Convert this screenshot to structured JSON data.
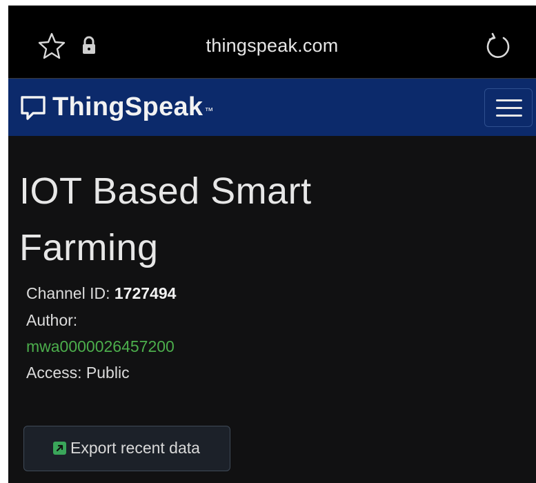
{
  "browser": {
    "url": "thingspeak.com",
    "icons": [
      "star-icon",
      "lock-icon",
      "reload-icon"
    ]
  },
  "navbar": {
    "brand": "ThingSpeak",
    "trademark": "™",
    "background_color": "#0c2a6b",
    "icons": [
      "chat-bubble-logo-icon",
      "hamburger-menu-icon"
    ]
  },
  "channel": {
    "title_line1": "IOT Based Smart",
    "title_line2": "Farming",
    "id_label": "Channel ID: ",
    "id_value": "1727494",
    "author_label": "Author:",
    "author_value": "mwa0000026457200",
    "author_color": "#4cae4c",
    "access_label": "Access: ",
    "access_value": "Public"
  },
  "actions": {
    "export_label": "Export recent data",
    "export_icon": "external-link-icon",
    "export_icon_color": "#3aa65a"
  }
}
